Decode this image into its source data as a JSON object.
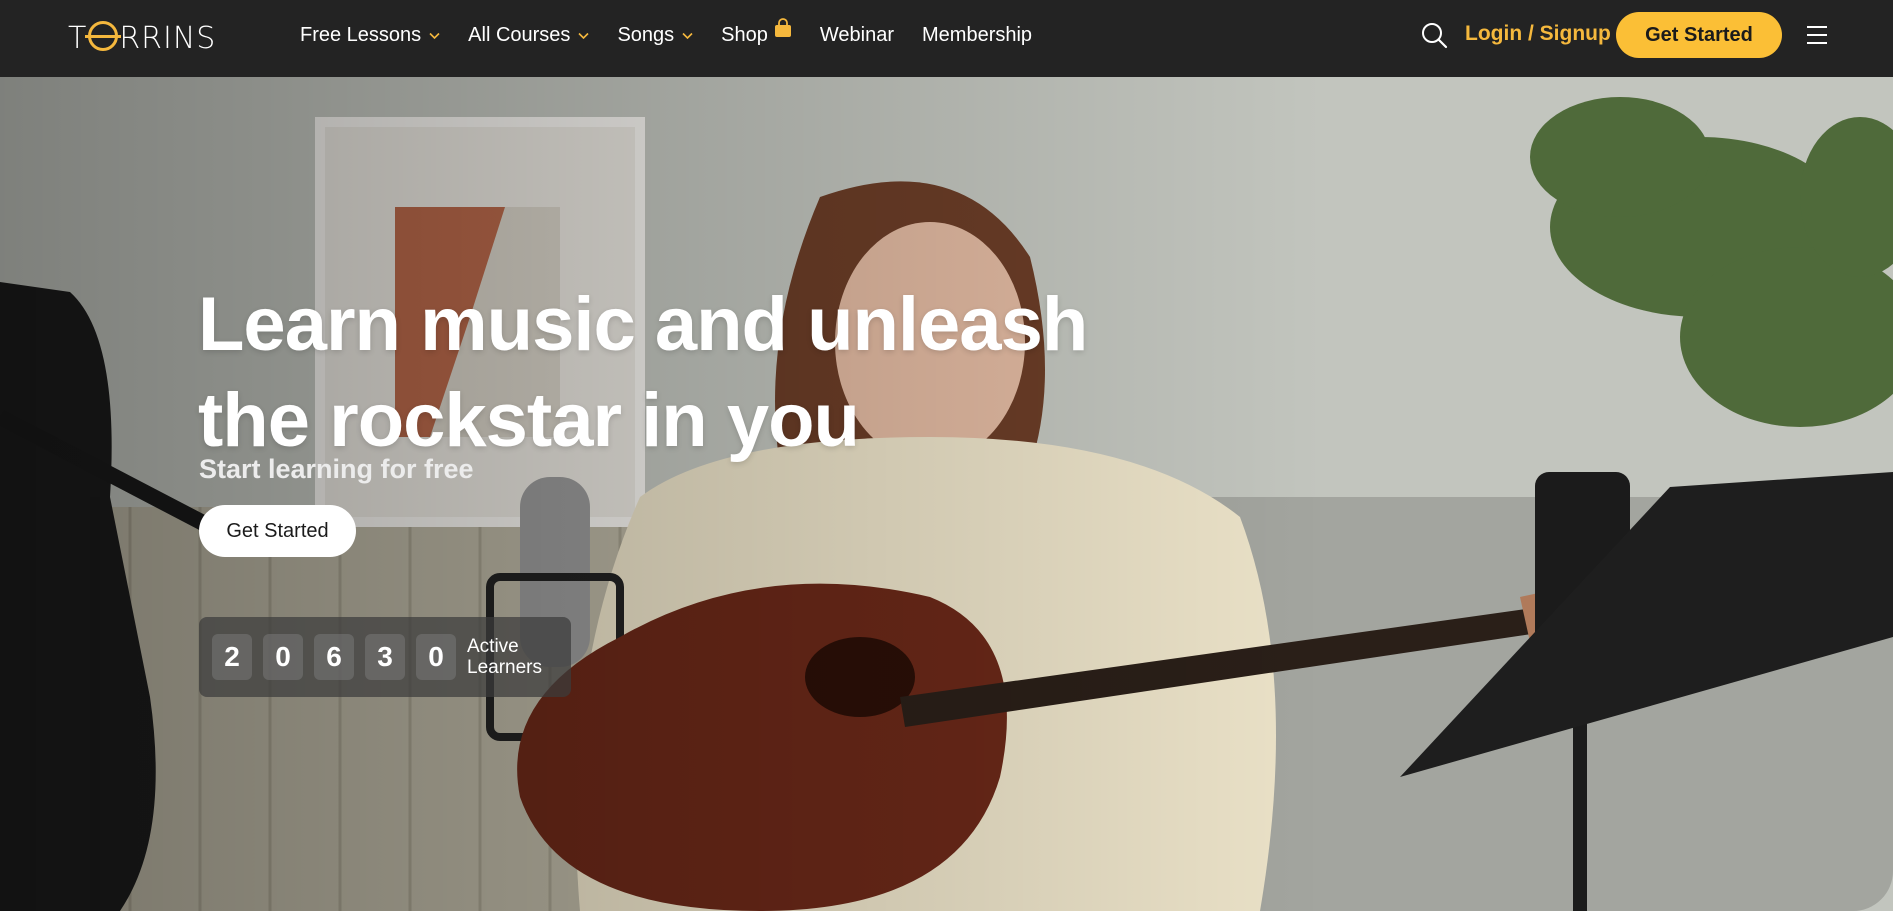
{
  "brand": {
    "logo_text": "TORRINS"
  },
  "nav": {
    "items": [
      {
        "label": "Free Lessons",
        "has_dropdown": true
      },
      {
        "label": "All Courses",
        "has_dropdown": true
      },
      {
        "label": "Songs",
        "has_dropdown": true
      },
      {
        "label": "Shop",
        "has_dropdown": false,
        "icon": "shopping-bag-icon"
      },
      {
        "label": "Webinar",
        "has_dropdown": false
      },
      {
        "label": "Membership",
        "has_dropdown": false
      }
    ],
    "login_label": "Login / Signup",
    "cta_label": "Get Started"
  },
  "hero": {
    "title_line1": "Learn music and unleash",
    "title_line2": "the rockstar in you",
    "subtitle": "Start learning for free",
    "cta_label": "Get Started",
    "learners": {
      "digits": [
        "2",
        "0",
        "6",
        "3",
        "0"
      ],
      "label": "Active Learners"
    }
  },
  "colors": {
    "accent": "#fbbf36",
    "login_text": "#f5b83d",
    "nav_bg": "#232323"
  }
}
